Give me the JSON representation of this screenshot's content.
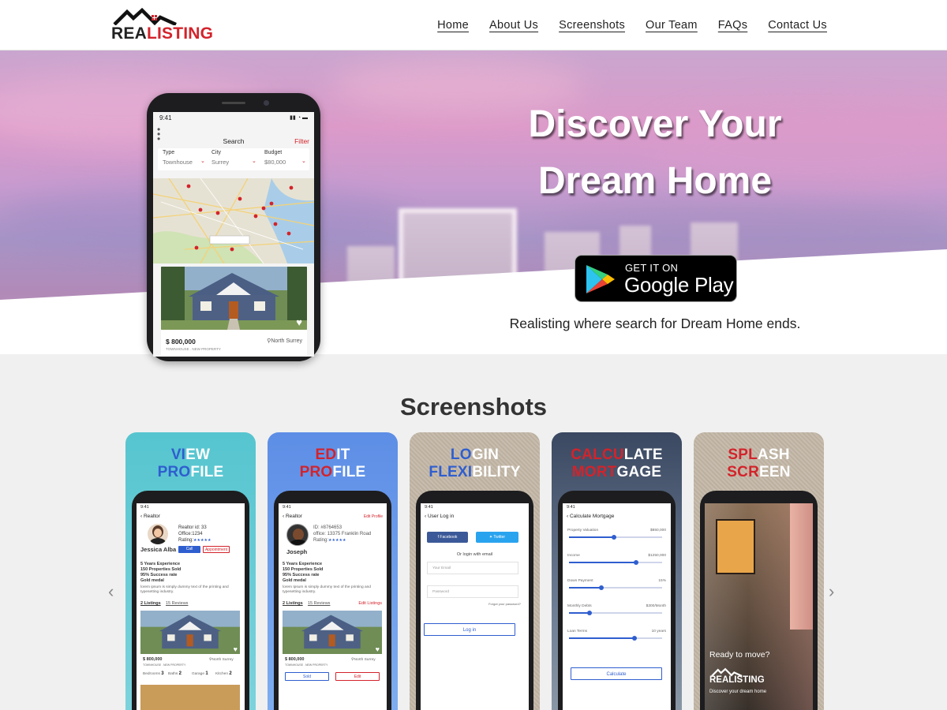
{
  "brand": {
    "part1": "REA",
    "part2": "LISTING",
    "accent": "#d3232b"
  },
  "nav": [
    "Home",
    "About Us",
    "Screenshots",
    "Our Team",
    "FAQs",
    "Contact Us"
  ],
  "hero": {
    "title_line1": "Discover Your",
    "title_line2": "Dream Home",
    "tagline": "Realisting where search for Dream Home ends.",
    "badge_small": "GET IT ON",
    "badge_big": "Google Play",
    "phone": {
      "time": "9:41",
      "title": "Search",
      "filter": "Filter",
      "fields": [
        {
          "label": "Type",
          "value": "Townhouse"
        },
        {
          "label": "City",
          "value": "Surrey"
        },
        {
          "label": "Budget",
          "value": "$80,000"
        }
      ],
      "price": "$ 800,000",
      "location": "North Surrey",
      "subtitle": "TOWNHOUSE . NEW PROPERTY"
    }
  },
  "screenshots": {
    "title": "Screenshots",
    "prev_arrow": "‹",
    "next_arrow": "›",
    "view_profile": {
      "h1a": "VI",
      "h1b": "EW",
      "h2a": "PRO",
      "h2b": "FILE",
      "time": "9:41",
      "header": "Realtor",
      "id": "Realtor id: 33",
      "office": "Office:1234",
      "rating": "Rating:",
      "name": "Jessica Alba",
      "call": "Call",
      "appointment": "Appointment",
      "stats": [
        "5 Years Experience",
        "150 Properties Sold",
        "95% Success rate",
        "Gold medal"
      ],
      "lorem": [
        "lorem ipsum is simply dummy text of the printing and",
        "typesetting industry."
      ],
      "tab1": "2 Listings",
      "tab2": "15 Reviews",
      "price": "$ 800,000",
      "location": "North Surrey",
      "subtitle": "TOWNHOUSE . NEW PROPERTY",
      "features": [
        {
          "n": "3",
          "l": "Bedrooms"
        },
        {
          "n": "2",
          "l": "Baths"
        },
        {
          "n": "1",
          "l": "Garage"
        },
        {
          "n": "2",
          "l": "Kitchen"
        }
      ]
    },
    "edit_profile": {
      "h1a": "ED",
      "h1b": "IT",
      "h2a": "PRO",
      "h2b": "FILE",
      "time": "9:41",
      "header": "Realtor",
      "edit": "Edit Profile",
      "id": "ID: #8764653",
      "office": "office: 13375 Franklin Road",
      "rating": "Rating:",
      "name": "Joseph",
      "stats": [
        "5 Years Experience",
        "150 Properties Sold",
        "95% Success rate",
        "Gold medal"
      ],
      "lorem": [
        "lorem Ipsum is simply dummy text of the printing and",
        "typesetting industry."
      ],
      "tab1": "2 Listings",
      "tab2": "15 Reviews",
      "edit_listings": "Edit Listings",
      "price": "$ 800,000",
      "location": "North Surrey",
      "subtitle": "TOWNHOUSE . NEW PROPERTY",
      "sold": "Sold",
      "edit_btn": "Edit"
    },
    "login": {
      "h1a": "LO",
      "h1b": "GIN",
      "h2a": "FLEXI",
      "h2b": "BILITY",
      "time": "9:41",
      "header": "User Log in",
      "facebook": "Facebook",
      "twitter": "Twitter",
      "or": "Or login with email",
      "email_placeholder": "Your Email",
      "password_placeholder": "Password",
      "forgot": "Forgot your password?",
      "login_btn": "Log in"
    },
    "calculate": {
      "h1a": "CALCU",
      "h1b": "LATE",
      "h2a": "MORT",
      "h2b": "GAGE",
      "time": "9:41",
      "header": "Calculate Mortgage",
      "rows": [
        {
          "label": "Property Valuation",
          "value": "$850,000",
          "level": 0.48
        },
        {
          "label": "Income",
          "value": "$1250,000",
          "level": 0.72
        },
        {
          "label": "Down Payment",
          "value": "15%",
          "level": 0.35
        },
        {
          "label": "Monthly Debts",
          "value": "$300/Month",
          "level": 0.22
        },
        {
          "label": "Loan Terms",
          "value": "10 years",
          "level": 0.7
        }
      ],
      "button": "Calculate"
    },
    "splash": {
      "h1a": "SPL",
      "h1b": "ASH",
      "h2a": "SCR",
      "h2b": "EEN",
      "ready": "Ready to move?",
      "brand": "REALISTING",
      "sub": "Discover your dream home"
    }
  }
}
